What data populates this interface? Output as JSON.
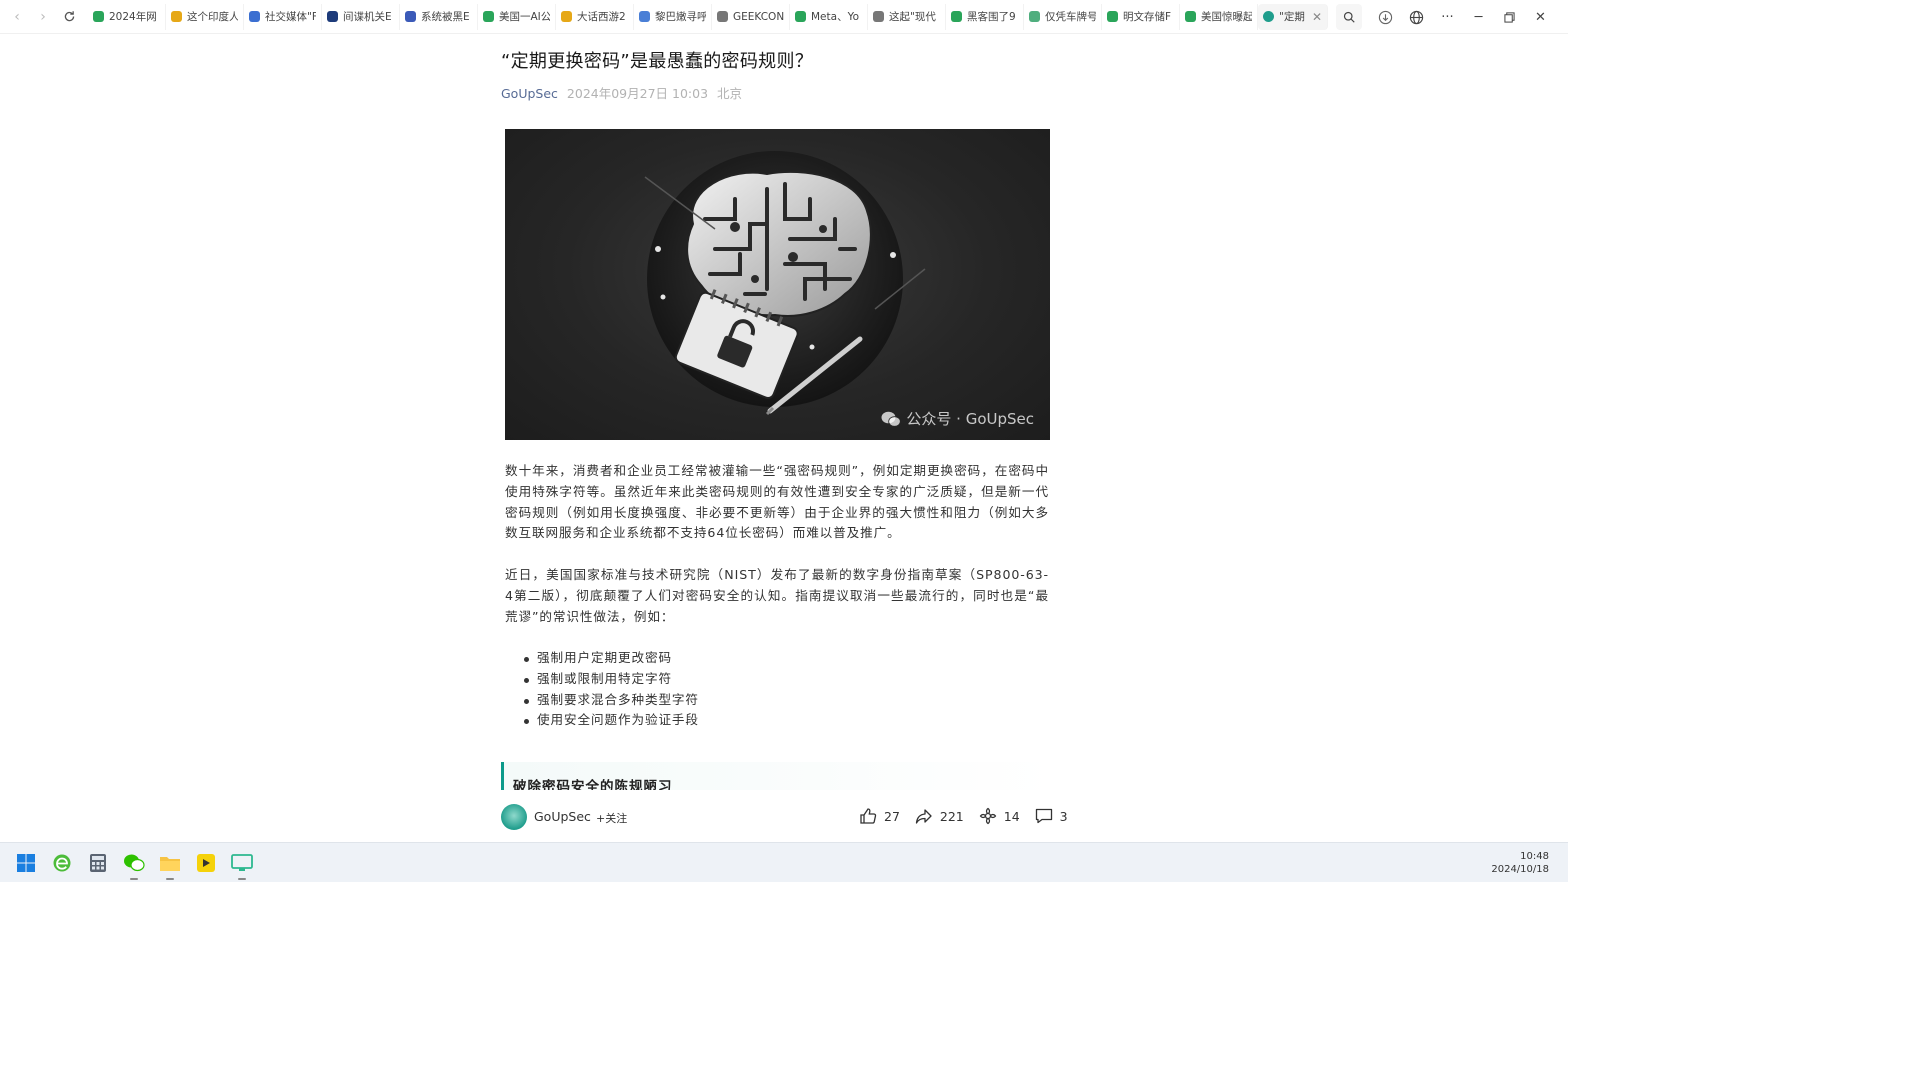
{
  "browser": {
    "tabs": [
      {
        "label": "2024年网",
        "color": "#2aa55a"
      },
      {
        "label": "这个印度人",
        "color": "#e6a817"
      },
      {
        "label": "社交媒体\"F",
        "color": "#3b6fd1"
      },
      {
        "label": "间谍机关E",
        "color": "#1d3b7a"
      },
      {
        "label": "系统被黑E",
        "color": "#3b5ab8"
      },
      {
        "label": "美国一AI公",
        "color": "#2aa55a"
      },
      {
        "label": "大话西游2",
        "color": "#e6a817"
      },
      {
        "label": "黎巴嫩寻呼",
        "color": "#4a7fd6"
      },
      {
        "label": "GEEKCON",
        "color": "#777777"
      },
      {
        "label": "Meta、Yo",
        "color": "#2aa55a"
      },
      {
        "label": "这起\"现代",
        "color": "#777777"
      },
      {
        "label": "黑客围了9",
        "color": "#2aa55a"
      },
      {
        "label": "仅凭车牌号",
        "color": "#4fae7e"
      },
      {
        "label": "明文存储F",
        "color": "#2aa55a"
      },
      {
        "label": "美国惊曝起",
        "color": "#2aa55a"
      }
    ],
    "active_tab": {
      "label": "\"定期",
      "color": "#1f9d8c"
    }
  },
  "article": {
    "title": "“定期更换密码”是最愚蠢的密码规则？",
    "author": "GoUpSec",
    "date": "2024年09月27日 10:03",
    "location": "北京",
    "image_watermark": "公众号 · GoUpSec",
    "paragraph1": "数十年来，消费者和企业员工经常被灌输一些“强密码规则”，例如定期更换密码，在密码中使用特殊字符等。虽然近年来此类密码规则的有效性遭到安全专家的广泛质疑，但是新一代密码规则（例如用长度换强度、非必要不更新等）由于企业界的强大惯性和阻力（例如大多数互联网服务和企业系统都不支持64位长密码）而难以普及推广。",
    "paragraph2": "近日，美国国家标准与技术研究院（NIST）发布了最新的数字身份指南草案（SP800-63-4第二版），彻底颠覆了人们对密码安全的认知。指南提议取消一些最流行的，同时也是“最荒谬”的常识性做法，例如：",
    "bullets": [
      "强制用户定期更改密码",
      "强制或限制用特定字符",
      "强制要求混合多种类型字符",
      "使用安全问题作为验证手段"
    ],
    "section_heading": "破除密码安全的陈规陋习"
  },
  "action_bar": {
    "account_name": "GoUpSec",
    "follow_label": "+关注",
    "likes": "27",
    "shares": "221",
    "recommends": "14",
    "comments": "3"
  },
  "taskbar": {
    "time": "10:48",
    "date": "2024/10/18"
  }
}
